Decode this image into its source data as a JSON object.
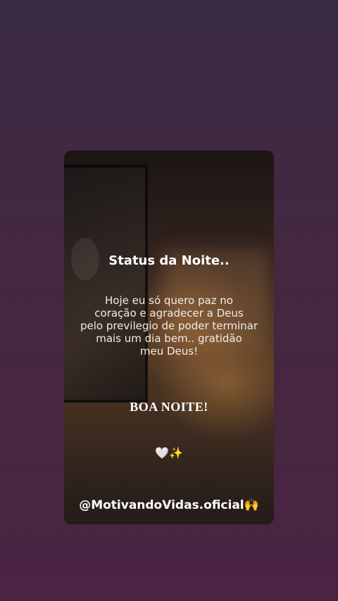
{
  "post": {
    "title": "Status da Noite..",
    "message_lines": [
      "Hoje eu só quero paz no",
      "coração e agradecer a Deus",
      "pelo previlegio de poder terminar",
      "mais um dia bem.. gratidão",
      "meu Deus!"
    ],
    "greeting": "BOA NOITE!",
    "emoji_line": "🤍✨",
    "handle": "@MotivandoVidas.oficial🙌"
  }
}
